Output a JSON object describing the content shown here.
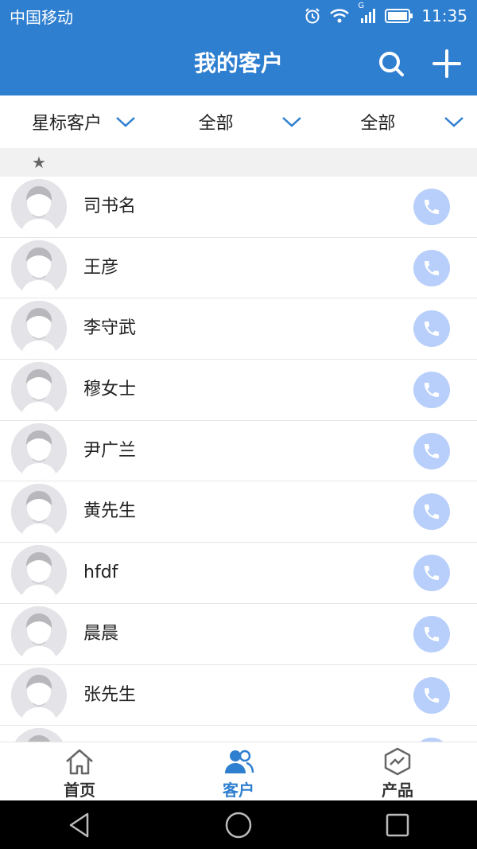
{
  "status_bar": {
    "carrier": "中国移动",
    "network": "G",
    "time": "11:35"
  },
  "app_bar": {
    "title": "我的客户",
    "icons": [
      "search-icon",
      "plus-icon"
    ]
  },
  "filters": [
    {
      "label": "星标客户"
    },
    {
      "label": "全部"
    },
    {
      "label": "全部"
    }
  ],
  "section": {
    "marker": "★"
  },
  "customers": [
    {
      "name": "司书名"
    },
    {
      "name": "王彦"
    },
    {
      "name": "李守武"
    },
    {
      "name": "穆女士"
    },
    {
      "name": "尹广兰"
    },
    {
      "name": "黄先生"
    },
    {
      "name": "hfdf"
    },
    {
      "name": "晨晨"
    },
    {
      "name": "张先生"
    }
  ],
  "tabs": [
    {
      "label": "首页",
      "icon": "home-icon",
      "active": false
    },
    {
      "label": "客户",
      "icon": "customers-icon",
      "active": true
    },
    {
      "label": "产品",
      "icon": "product-icon",
      "active": false
    }
  ],
  "colors": {
    "primary": "#2f7fd1",
    "call_button": "#b7cffa",
    "section_bg": "#f1f1f1"
  }
}
